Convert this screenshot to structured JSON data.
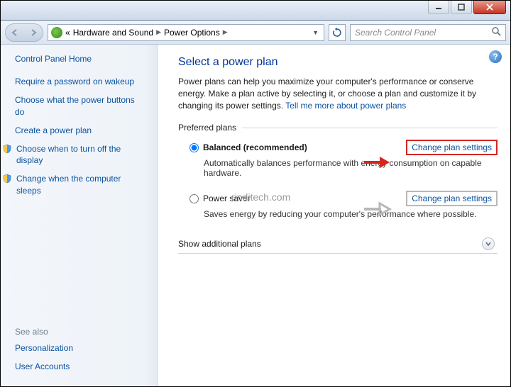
{
  "window": {
    "min": "—",
    "max": "□",
    "close": "✕"
  },
  "breadcrumb": {
    "lead": "«",
    "item1": "Hardware and Sound",
    "item2": "Power Options"
  },
  "search": {
    "placeholder": "Search Control Panel"
  },
  "sidebar": {
    "home": "Control Panel Home",
    "links": [
      "Require a password on wakeup",
      "Choose what the power buttons do",
      "Create a power plan",
      "Choose when to turn off the display",
      "Change when the computer sleeps"
    ],
    "seealso_label": "See also",
    "seealso": [
      "Personalization",
      "User Accounts"
    ]
  },
  "main": {
    "title": "Select a power plan",
    "intro": "Power plans can help you maximize your computer's performance or conserve energy. Make a plan active by selecting it, or choose a plan and customize it by changing its power settings. ",
    "intro_link": "Tell me more about power plans",
    "preferred_label": "Preferred plans",
    "plans": [
      {
        "title": "Balanced (recommended)",
        "desc": "Automatically balances performance with energy consumption on capable hardware.",
        "link": "Change plan settings"
      },
      {
        "title": "Power saver",
        "desc": "Saves energy by reducing your computer's performance where possible.",
        "link": "Change plan settings"
      }
    ],
    "show_more": "Show additional plans"
  },
  "watermark": "rinditech.com"
}
